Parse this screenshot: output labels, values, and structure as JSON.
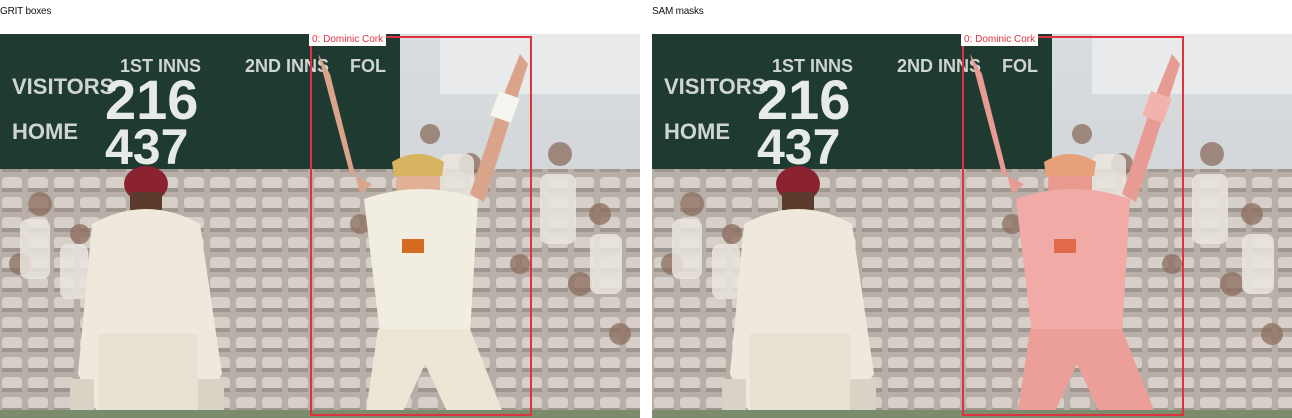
{
  "panels": [
    {
      "title": "GRIT boxes",
      "detections": [
        {
          "label": "0: Dominic Cork",
          "color": "#e0313f",
          "mask": false
        }
      ]
    },
    {
      "title": "SAM masks",
      "detections": [
        {
          "label": "0: Dominic Cork",
          "color": "#e0313f",
          "mask": true
        }
      ]
    }
  ],
  "scoreboard": {
    "row1_label": "VISITORS",
    "row2_label": "HOME",
    "visitors_score": "216",
    "home_score": "437",
    "header_1": "1ST INNS",
    "header_2": "2ND INNS",
    "header_3": "FOL"
  }
}
